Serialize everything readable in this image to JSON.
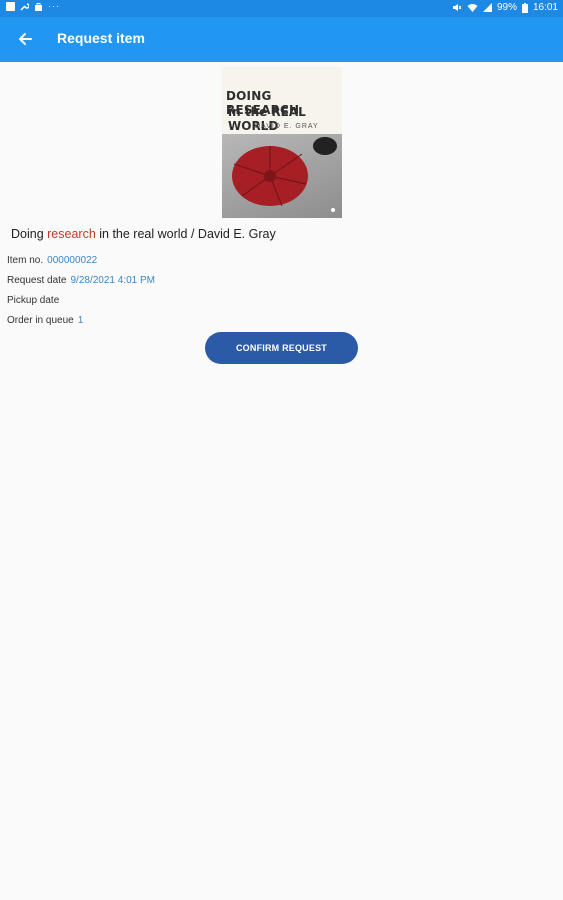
{
  "status_bar": {
    "battery": "99%",
    "time": "16:01",
    "overflow": "···"
  },
  "app_bar": {
    "title": "Request item"
  },
  "book": {
    "cover": {
      "title_line1": "DOING RESEARCH",
      "title_line2": "in the REAL WORLD",
      "author": "DAVID E. GRAY"
    },
    "title_prefix": "Doing ",
    "title_highlight": "research",
    "title_suffix": " in the real world / David E. Gray"
  },
  "details": {
    "item_no_label": "Item no.",
    "item_no_value": "000000022",
    "request_date_label": "Request date",
    "request_date_value": "9/28/2021 4:01 PM",
    "pickup_date_label": "Pickup date",
    "order_label": "Order in queue",
    "order_value": "1"
  },
  "actions": {
    "confirm_label": "CONFIRM REQUEST"
  },
  "colors": {
    "app_bar": "#2196f3",
    "status_bar": "#1e88e5",
    "button": "#2b5aa6",
    "link_value": "#3c86c6",
    "highlight": "#c0392b"
  }
}
